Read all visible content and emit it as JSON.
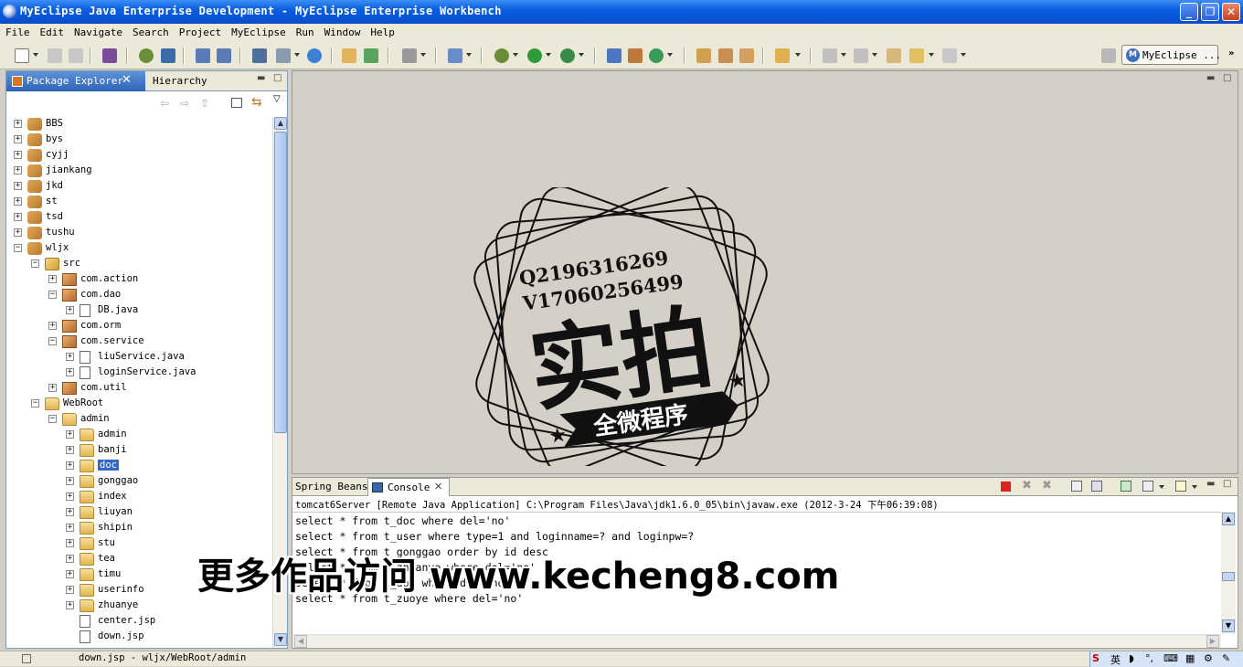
{
  "window": {
    "title": "MyEclipse Java Enterprise Development - MyEclipse Enterprise Workbench",
    "minimize": "_",
    "maximize": "❐",
    "close": "✕"
  },
  "menubar": [
    "File",
    "Edit",
    "Navigate",
    "Search",
    "Project",
    "MyEclipse",
    "Run",
    "Window",
    "Help"
  ],
  "toolbar": {
    "perspective_label": "MyEclipse ...",
    "perspective_icon": "myeclipse-logo-icon"
  },
  "package_explorer": {
    "tab_label": "Package Explorer",
    "tab_close": "✕",
    "hierarchy_tab": "Hierarchy",
    "tree": [
      {
        "label": "BBS",
        "icon": "project-icon",
        "level": 0,
        "expander": "+"
      },
      {
        "label": "bys",
        "icon": "project-icon",
        "level": 0,
        "expander": "+"
      },
      {
        "label": "cyjj",
        "icon": "project-icon",
        "level": 0,
        "expander": "+"
      },
      {
        "label": "jiankang",
        "icon": "project-icon",
        "level": 0,
        "expander": "+"
      },
      {
        "label": "jkd",
        "icon": "project-icon",
        "level": 0,
        "expander": "+"
      },
      {
        "label": "st",
        "icon": "project-icon",
        "level": 0,
        "expander": "+"
      },
      {
        "label": "tsd",
        "icon": "project-icon",
        "level": 0,
        "expander": "+"
      },
      {
        "label": "tushu",
        "icon": "project-icon",
        "level": 0,
        "expander": "+"
      },
      {
        "label": "wljx",
        "icon": "project-icon",
        "level": 0,
        "expander": "−"
      },
      {
        "label": "src",
        "icon": "source-folder-icon",
        "level": 1,
        "expander": "−"
      },
      {
        "label": "com.action",
        "icon": "package-icon",
        "level": 2,
        "expander": "+"
      },
      {
        "label": "com.dao",
        "icon": "package-icon",
        "level": 2,
        "expander": "−"
      },
      {
        "label": "DB.java",
        "icon": "java-file-icon",
        "level": 3,
        "expander": "+"
      },
      {
        "label": "com.orm",
        "icon": "package-icon",
        "level": 2,
        "expander": "+"
      },
      {
        "label": "com.service",
        "icon": "package-icon",
        "level": 2,
        "expander": "−"
      },
      {
        "label": "liuService.java",
        "icon": "java-file-icon",
        "level": 3,
        "expander": "+"
      },
      {
        "label": "loginService.java",
        "icon": "java-file-icon",
        "level": 3,
        "expander": "+"
      },
      {
        "label": "com.util",
        "icon": "package-icon",
        "level": 2,
        "expander": "+"
      },
      {
        "label": "WebRoot",
        "icon": "folder-icon",
        "level": 1,
        "expander": "−"
      },
      {
        "label": "admin",
        "icon": "folder-icon",
        "level": 2,
        "expander": "−"
      },
      {
        "label": "admin",
        "icon": "folder-icon",
        "level": 3,
        "expander": "+"
      },
      {
        "label": "banji",
        "icon": "folder-icon",
        "level": 3,
        "expander": "+"
      },
      {
        "label": "doc",
        "icon": "folder-icon",
        "level": 3,
        "expander": "+",
        "selected": true
      },
      {
        "label": "gonggao",
        "icon": "folder-icon",
        "level": 3,
        "expander": "+"
      },
      {
        "label": "index",
        "icon": "folder-icon",
        "level": 3,
        "expander": "+"
      },
      {
        "label": "liuyan",
        "icon": "folder-icon",
        "level": 3,
        "expander": "+"
      },
      {
        "label": "shipin",
        "icon": "folder-icon",
        "level": 3,
        "expander": "+"
      },
      {
        "label": "stu",
        "icon": "folder-icon",
        "level": 3,
        "expander": "+"
      },
      {
        "label": "tea",
        "icon": "folder-icon",
        "level": 3,
        "expander": "+"
      },
      {
        "label": "timu",
        "icon": "folder-icon",
        "level": 3,
        "expander": "+"
      },
      {
        "label": "userinfo",
        "icon": "folder-icon",
        "level": 3,
        "expander": "+"
      },
      {
        "label": "zhuanye",
        "icon": "folder-icon",
        "level": 3,
        "expander": "+"
      },
      {
        "label": "center.jsp",
        "icon": "jsp-file-icon",
        "level": 3,
        "expander": ""
      },
      {
        "label": "down.jsp",
        "icon": "jsp-file-icon",
        "level": 3,
        "expander": ""
      }
    ]
  },
  "stamp": {
    "qq": "Q2196316269",
    "wechat": "V17060256499",
    "main": "实拍",
    "ribbon": "全微程序"
  },
  "console": {
    "spring_tab": "Spring Beans",
    "console_tab": "Console",
    "tab_close": "✕",
    "header": "tomcat6Server [Remote Java Application] C:\\Program Files\\Java\\jdk1.6.0_05\\bin\\javaw.exe (2012-3-24 下午06:39:08)",
    "lines": [
      "select * from t_doc where del='no'",
      "select * from t_user where type=1 and loginname=? and loginpw=?",
      "select * from t_gonggao order by id desc",
      "select * from t_zhuanye where del='no'",
      "select * from t_doc where del='no'",
      "select * from t_zuoye where del='no'"
    ]
  },
  "watermark": "更多作品访问 www.kecheng8.com",
  "statusbar": {
    "text": "down.jsp - wljx/WebRoot/admin",
    "ime_label": "英"
  }
}
